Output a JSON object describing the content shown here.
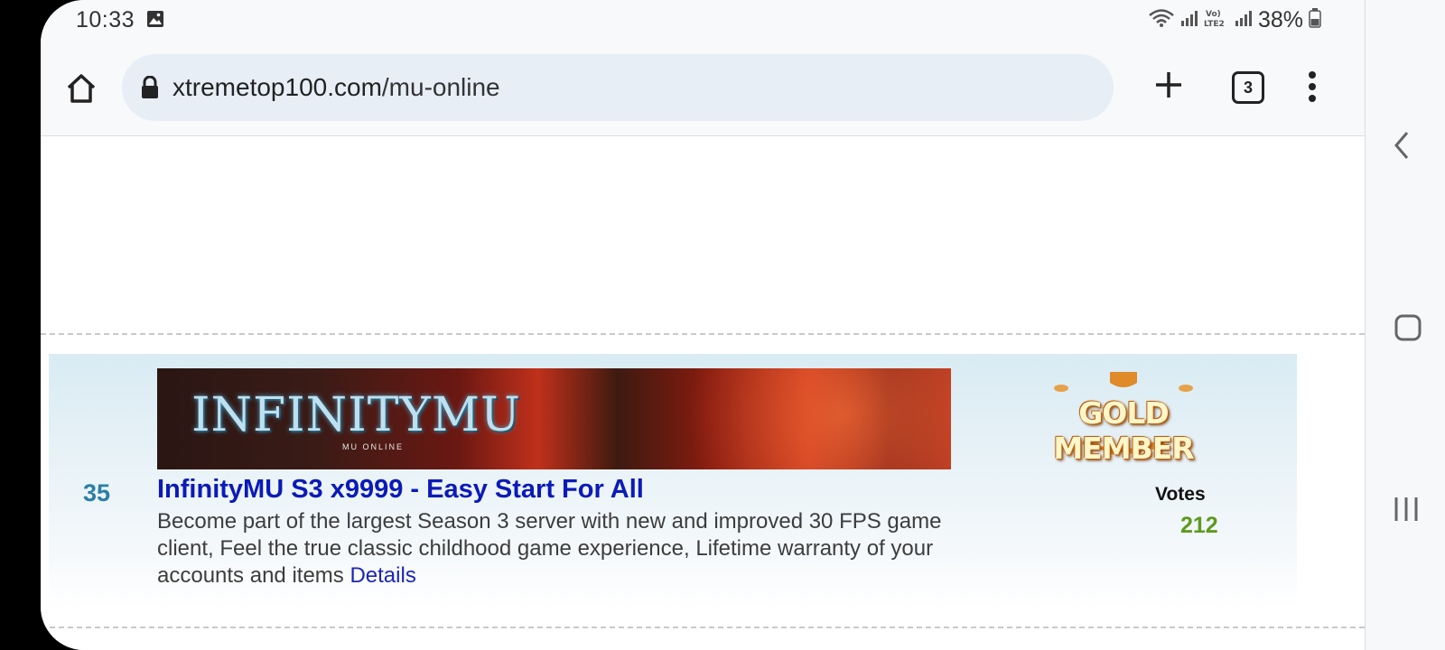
{
  "status_bar": {
    "time": "10:33",
    "battery": "38%",
    "network_label": "Vo) LTE2",
    "icons": [
      "gallery-icon",
      "wifi-icon",
      "signal-icon",
      "volte-icon",
      "signal-icon",
      "battery-icon"
    ]
  },
  "browser": {
    "url_domain": "xtremetop100.com",
    "url_path": "/mu-online",
    "tab_count": "3",
    "icons": [
      "home-icon",
      "lock-icon",
      "plus-icon",
      "tabs-icon",
      "more-vert-icon"
    ]
  },
  "listing": {
    "rank": "35",
    "banner_logo": "INFINITYMU",
    "banner_sub": "MU ONLINE",
    "badge": "GOLD MEMBER",
    "title": "InfinityMU S3 x9999 - Easy Start For All",
    "description": "Become part of the largest Season 3 server with new and improved 30 FPS game client, Feel the true classic childhood game experience, Lifetime warranty of your accounts and items",
    "details_link": "Details",
    "votes_label": "Votes",
    "votes_value": "212"
  },
  "nav_bar": {
    "icons": [
      "back-icon",
      "home-square-icon",
      "recent-apps-icon"
    ]
  },
  "colors": {
    "accent_title": "#0b1ab8",
    "rank": "#2a7fa6",
    "votes": "#5e9a1e",
    "url_pill": "#e7eef5"
  }
}
